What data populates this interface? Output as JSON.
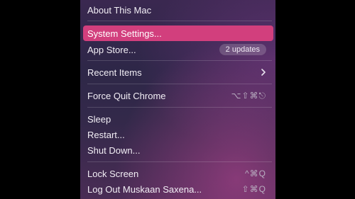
{
  "menu": {
    "items": {
      "about": {
        "label": "About This Mac"
      },
      "settings": {
        "label": "System Settings..."
      },
      "app_store": {
        "label": "App Store...",
        "badge": "2 updates"
      },
      "recent": {
        "label": "Recent Items",
        "submenu_icon": "chevron-right-icon"
      },
      "force_quit": {
        "label": "Force Quit Chrome",
        "shortcut": "⌥⇧⌘⎋"
      },
      "sleep": {
        "label": "Sleep"
      },
      "restart": {
        "label": "Restart..."
      },
      "shutdown": {
        "label": "Shut Down..."
      },
      "lock": {
        "label": "Lock Screen",
        "shortcut": "^⌘Q"
      },
      "logout": {
        "label": "Log Out Muskaan Saxena...",
        "shortcut": "⇧⌘Q"
      }
    },
    "highlighted_item": "settings"
  },
  "colors": {
    "highlight": "#d23f7d",
    "text": "#f2eef5",
    "shortcut_text": "#b8adc0",
    "background_outer": "#000000"
  }
}
